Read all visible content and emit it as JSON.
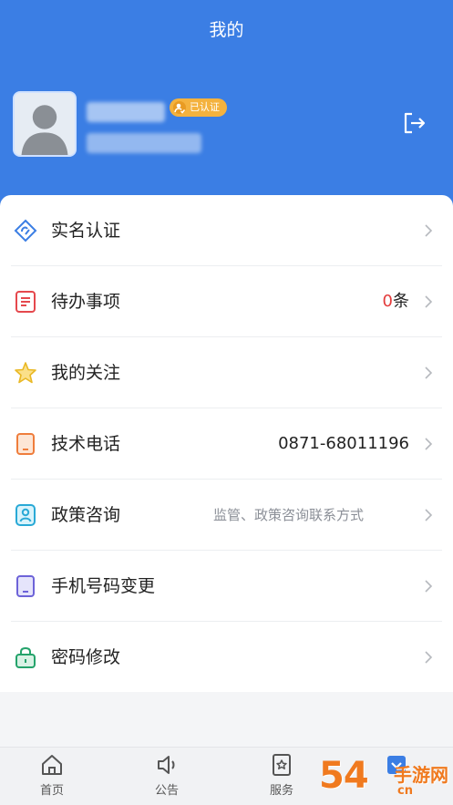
{
  "header": {
    "title": "我的"
  },
  "profile": {
    "badge_label": "已认证"
  },
  "menu": [
    {
      "label": "实名认证",
      "icon": "verify-icon"
    },
    {
      "label": "待办事项",
      "icon": "todo-icon",
      "count": "0",
      "unit": "条"
    },
    {
      "label": "我的关注",
      "icon": "star-icon"
    },
    {
      "label": "技术电话",
      "icon": "phone-icon",
      "value": "0871-68011196"
    },
    {
      "label": "政策咨询",
      "icon": "contact-icon",
      "hint": "监管、政策咨询联系方式"
    },
    {
      "label": "手机号码变更",
      "icon": "mobile-icon"
    },
    {
      "label": "密码修改",
      "icon": "lock-icon"
    }
  ],
  "tabs": [
    {
      "label": "首页",
      "icon": "home-icon"
    },
    {
      "label": "公告",
      "icon": "speaker-icon"
    },
    {
      "label": "服务",
      "icon": "service-icon"
    },
    {
      "label": "",
      "icon": "mine-icon"
    }
  ],
  "watermark": {
    "number": "54",
    "text": "手游网",
    "url": "cn"
  },
  "colors": {
    "primary": "#3b7ee4",
    "badge": "#f4b23e",
    "count": "#e33b3b"
  }
}
